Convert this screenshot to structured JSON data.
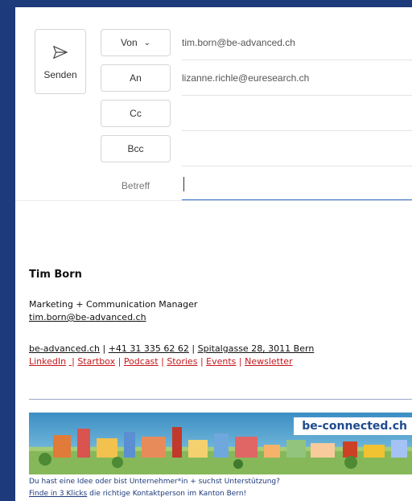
{
  "compose": {
    "send_label": "Senden",
    "from_label": "Von",
    "from_value": "tim.born@be-advanced.ch",
    "to_label": "An",
    "to_value": "lizanne.richle@euresearch.ch",
    "cc_label": "Cc",
    "bcc_label": "Bcc",
    "subject_label": "Betreff",
    "subject_value": ""
  },
  "signature": {
    "name": "Tim Born",
    "role": "Marketing + Communication Manager",
    "email": "tim.born@be-advanced.ch",
    "website": "be-advanced.ch",
    "phone": "+41 31 335 62 62",
    "address": "Spitalgasse 28, 3011 Bern",
    "links": [
      "LinkedIn",
      "Startbox",
      "Podcast",
      "Stories",
      "Events",
      "Newsletter"
    ],
    "separator": "|"
  },
  "banner": {
    "tag": "be-connected.ch",
    "line1": "Du hast eine Idee oder bist Unternehmer*in + suchst Unterstützung?",
    "line2_link": "Finde in 3 Klicks",
    "line2_rest": " die richtige Kontaktperson im Kanton Bern!"
  },
  "colors": {
    "frame": "#1d3a7a",
    "accent": "#2b6cc4",
    "link_red": "#c4161c"
  }
}
